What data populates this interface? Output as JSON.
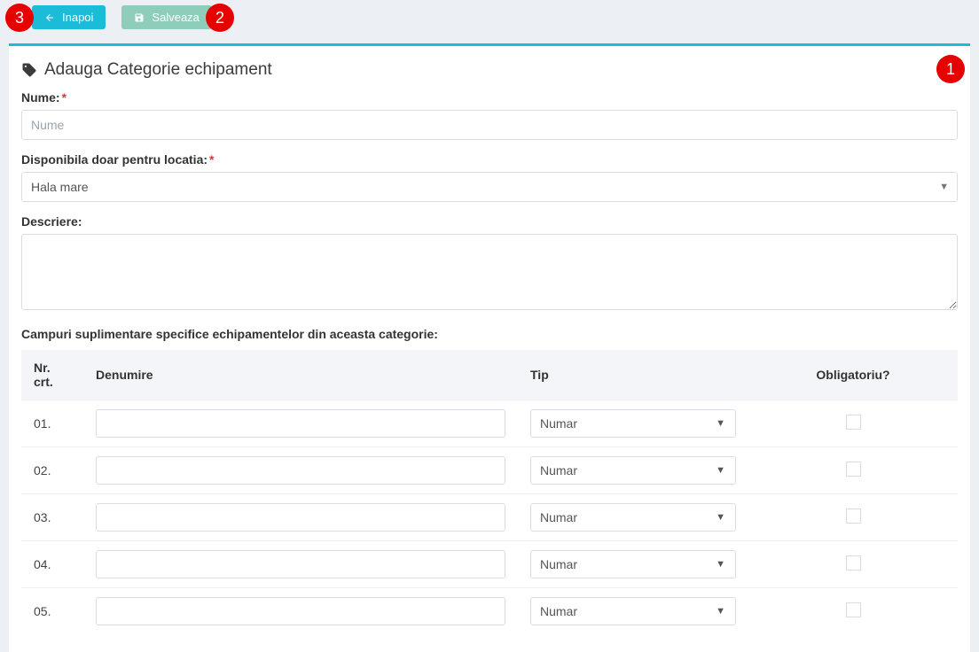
{
  "toolbar": {
    "back_label": "Inapoi",
    "save_label": "Salveaza"
  },
  "panel": {
    "title": "Adauga Categorie echipament"
  },
  "labels": {
    "name": "Nume:",
    "name_placeholder": "Nume",
    "location": "Disponibila doar pentru locatia:",
    "location_selected": "Hala mare",
    "description": "Descriere:",
    "extra_fields_section": "Campuri suplimentare specifice echipamentelor din aceasta categorie:"
  },
  "table": {
    "headers": {
      "nr": "Nr. crt.",
      "name": "Denumire",
      "type": "Tip",
      "mandatory": "Obligatoriu?"
    },
    "rows": [
      {
        "nr": "01.",
        "name": "",
        "type": "Numar",
        "mandatory": false
      },
      {
        "nr": "02.",
        "name": "",
        "type": "Numar",
        "mandatory": false
      },
      {
        "nr": "03.",
        "name": "",
        "type": "Numar",
        "mandatory": false
      },
      {
        "nr": "04.",
        "name": "",
        "type": "Numar",
        "mandatory": false
      },
      {
        "nr": "05.",
        "name": "",
        "type": "Numar",
        "mandatory": false
      }
    ]
  },
  "markers": {
    "m1": "1",
    "m2": "2",
    "m3": "3"
  }
}
